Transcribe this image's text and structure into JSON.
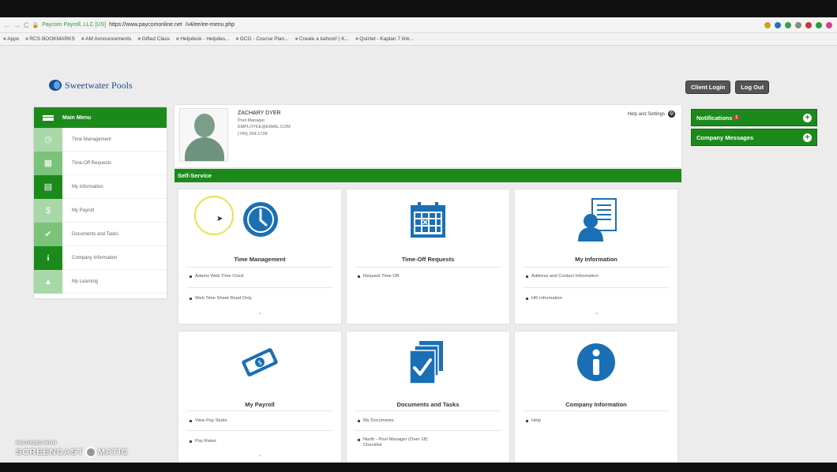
{
  "browser": {
    "tab_title": "Paycom Payroll, LLC [US]",
    "url_host": "https://www.paycomonline.net",
    "url_path": "/v4/ee/ee-menu.php",
    "bookmarks": [
      "Apps",
      "RCS BOOKMARKS",
      "AM Announcements",
      "Gifted Class",
      "Helpdesk - Helpdes...",
      "GCG - Course Plan...",
      "Create a kahoot! | K...",
      "Quizlet - Kaplan 7 link..."
    ]
  },
  "logo": {
    "text": "Sweetwater Pools"
  },
  "header_buttons": {
    "client_login": "Client Login",
    "log_out": "Log Out"
  },
  "sidebar": {
    "title": "Main Menu",
    "items": [
      {
        "label": "Time Management",
        "icon": "clock-icon"
      },
      {
        "label": "Time-Off Requests",
        "icon": "calendar-icon"
      },
      {
        "label": "My Information",
        "icon": "id-card-icon"
      },
      {
        "label": "My Payroll",
        "icon": "money-icon"
      },
      {
        "label": "Documents and Tasks",
        "icon": "checklist-icon"
      },
      {
        "label": "Company Information",
        "icon": "info-icon"
      },
      {
        "label": "My Learning",
        "icon": "graduation-icon"
      }
    ]
  },
  "profile": {
    "name": "ZACHARY DYER",
    "title": "Pool Manager",
    "email": "EMPLOYEE@EMAIL.COM",
    "phone": "(740) 264-1728",
    "help_settings": "Help and Settings"
  },
  "self_service_label": "Self-Service",
  "right_panel": {
    "notifications": "Notifications",
    "notifications_badge": "1",
    "company_messages": "Company Messages"
  },
  "cards": {
    "time_management": {
      "title": "Time Management",
      "links": [
        "Adams Web Time Clock",
        "Web Time Sheet Read Only"
      ]
    },
    "time_off": {
      "title": "Time-Off Requests",
      "links": [
        "Request Time Off"
      ]
    },
    "my_information": {
      "title": "My Information",
      "links": [
        "Address and Contact Information",
        "HR Information"
      ]
    },
    "my_payroll": {
      "title": "My Payroll",
      "links": [
        "View Pay Stubs",
        "Pay Rates"
      ]
    },
    "documents": {
      "title": "Documents and Tasks",
      "links": [
        "My Documents",
        "North - Pool Manager (Over 18) Checklist"
      ]
    },
    "company_info": {
      "title": "Company Information",
      "links": [
        "Help"
      ]
    }
  },
  "watermark": {
    "line1": "RECORDED WITH",
    "line2": "SCREENCAST",
    "line3": "MATIC"
  },
  "colors": {
    "brand_green": "#1b8a1b",
    "brand_blue": "#1a4e8c"
  }
}
